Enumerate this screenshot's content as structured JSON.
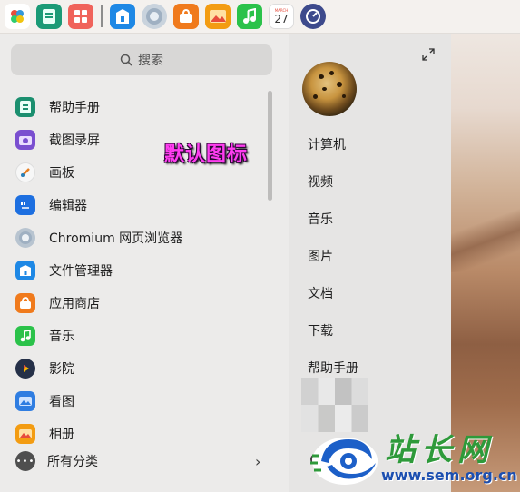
{
  "dock": {
    "icons": [
      "launcher-icon",
      "help-manual-icon",
      "app-grid-icon",
      "file-manager-icon",
      "browser-icon",
      "app-store-icon",
      "image-viewer-icon",
      "music-icon",
      "calendar-icon",
      "system-monitor-icon"
    ],
    "calendar_month": "MARCH",
    "calendar_day": "27"
  },
  "search": {
    "placeholder": "搜索"
  },
  "apps": [
    {
      "label": "帮助手册",
      "icon": "help-manual-icon",
      "color": "#1b8f6f"
    },
    {
      "label": "截图录屏",
      "icon": "screenshot-icon",
      "color": "#7a4fd0"
    },
    {
      "label": "画板",
      "icon": "draw-icon",
      "color": "#f2f2f2"
    },
    {
      "label": "编辑器",
      "icon": "editor-icon",
      "color": "#1d6fe0"
    },
    {
      "label": "Chromium 网页浏览器",
      "icon": "chromium-icon",
      "color": "#b8c4d0"
    },
    {
      "label": "文件管理器",
      "icon": "file-manager-icon",
      "color": "#1e88e5"
    },
    {
      "label": "应用商店",
      "icon": "app-store-icon",
      "color": "#f07a1c"
    },
    {
      "label": "音乐",
      "icon": "music-icon",
      "color": "#2bc24a"
    },
    {
      "label": "影院",
      "icon": "movie-icon",
      "color": "#253048"
    },
    {
      "label": "看图",
      "icon": "image-viewer-icon",
      "color": "#2f7de1"
    },
    {
      "label": "相册",
      "icon": "album-icon",
      "color": "#f39c12"
    }
  ],
  "all_categories": {
    "label": "所有分类",
    "icon_text": "•••"
  },
  "overlay_annotation": "默认图标",
  "places": [
    "计算机",
    "视频",
    "音乐",
    "图片",
    "文档",
    "下载",
    "帮助手册"
  ],
  "watermark": {
    "cn": "站长网",
    "url": "www.sem.org.cn"
  },
  "colors": {
    "accent": "#2f7de1",
    "overlay_text": "#ff3df0",
    "watermark_green": "#2e9a3a",
    "watermark_blue": "#1c4fb0"
  }
}
